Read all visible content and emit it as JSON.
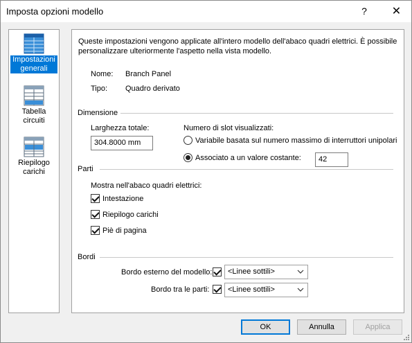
{
  "window": {
    "title": "Imposta opzioni modello",
    "help_label": "?",
    "close_label": "✕"
  },
  "sidebar": {
    "items": [
      {
        "label": "Impostazioni generali",
        "icon": "general-settings-icon",
        "active": true
      },
      {
        "label": "Tabella circuiti",
        "icon": "circuit-table-icon",
        "active": false
      },
      {
        "label": "Riepilogo carichi",
        "icon": "load-summary-icon",
        "active": false
      }
    ]
  },
  "content": {
    "intro": "Queste impostazioni vengono applicate all'intero modello dell'abaco quadri elettrici. È possibile personalizzare ulteriormente l'aspetto nella vista modello.",
    "name_label": "Nome:",
    "name_value": "Branch Panel",
    "type_label": "Tipo:",
    "type_value": "Quadro derivato",
    "dimension": {
      "title": "Dimensione",
      "width_label": "Larghezza totale:",
      "width_value": "304.8000 mm",
      "slots_label": "Numero di slot visualizzati:",
      "option_variable": "Variabile basata sul numero massimo di interruttori unipolari",
      "option_constant": "Associato a un valore costante:",
      "constant_value": "42"
    },
    "parts": {
      "title": "Parti",
      "show_label": "Mostra nell'abaco quadri elettrici:",
      "items": [
        {
          "label": "Intestazione",
          "checked": true
        },
        {
          "label": "Riepilogo carichi",
          "checked": true
        },
        {
          "label": "Piè di pagina",
          "checked": true
        }
      ]
    },
    "borders": {
      "title": "Bordi",
      "outer_label": "Bordo esterno del modello:",
      "outer_value": "<Linee sottili>",
      "inner_label": "Bordo tra le parti:",
      "inner_value": "<Linee sottili>"
    }
  },
  "footer": {
    "ok_label": "OK",
    "cancel_label": "Annulla",
    "apply_label": "Applica"
  }
}
